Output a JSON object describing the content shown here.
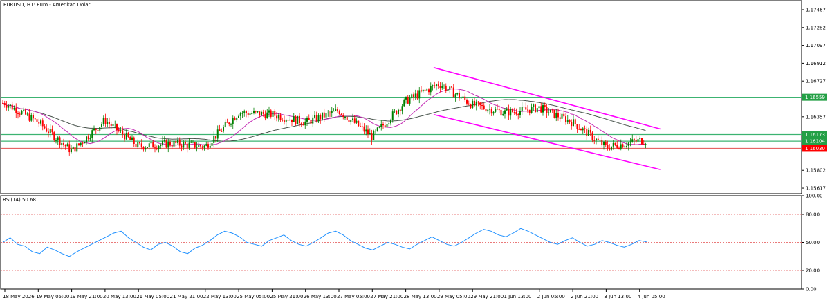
{
  "header": {
    "symbol_label": "EURUSD, H1:  Euro - Amerikan Dolari",
    "rsi_label": "RSI(14) 50.68"
  },
  "colors": {
    "background": "#ffffff",
    "frame": "#000000",
    "bull_candle": "#008000",
    "bear_candle": "#ff0000",
    "horizontal_level": "#3cb371",
    "bid_line": "#e34d4d",
    "channel": "#ff00ff",
    "ma_fast": "#c42ab4",
    "ma_slow": "#46524a",
    "rsi_line": "#1e90ff",
    "rsi_levels": "#e34d4d",
    "level_tag_bg": "#24a046",
    "bid_tag_bg": "#ff0000"
  },
  "chart_data": [
    {
      "type": "candlestick",
      "title": "EURUSD, H1:  Euro - Amerikan Dolari",
      "ylim": [
        1.1556,
        1.1756
      ],
      "y_ticks": [
        "1.17467",
        "1.17282",
        "1.17097",
        "1.16912",
        "1.16727",
        "1.16357",
        "1.15802",
        "1.15617"
      ],
      "x_ticks": [
        "18 May 2026",
        "19 May 05:00",
        "19 May 21:00",
        "20 May 13:00",
        "21 May 05:00",
        "21 May 21:00",
        "22 May 13:00",
        "25 May 05:00",
        "25 May 21:00",
        "26 May 13:00",
        "27 May 05:00",
        "27 May 21:00",
        "28 May 13:00",
        "29 May 05:00",
        "29 May 21:00",
        "1 Jun 13:00",
        "2 Jun 05:00",
        "2 Jun 21:00",
        "3 Jun 13:00",
        "4 Jun 05:00"
      ],
      "horizontal_levels": [
        {
          "value": 1.16559,
          "label": "1.16559"
        },
        {
          "value": 1.16173,
          "label": "1.16173"
        },
        {
          "value": 1.16104,
          "label": "1.16104"
        }
      ],
      "bid": {
        "value": 1.1603,
        "label": "1.16030"
      },
      "channel_lines": [
        {
          "from": [
            "29 May 05:00",
            1.16867
          ],
          "to": [
            "4 Jun 05:00",
            1.1623
          ]
        },
        {
          "from": [
            "29 May 05:00",
            1.1638
          ],
          "to": [
            "4 Jun 05:00",
            1.1581
          ]
        }
      ],
      "close_path": [
        [
          "18 May 2026",
          1.165
        ],
        [
          "19 May 05:00",
          1.163
        ],
        [
          "19 May 21:00",
          1.16
        ],
        [
          "20 May 13:00",
          1.1632
        ],
        [
          "21 May 05:00",
          1.1605
        ],
        [
          "21 May 21:00",
          1.1608
        ],
        [
          "22 May 13:00",
          1.1605
        ],
        [
          "25 May 05:00",
          1.164
        ],
        [
          "25 May 21:00",
          1.1638
        ],
        [
          "26 May 13:00",
          1.163
        ],
        [
          "27 May 05:00",
          1.1642
        ],
        [
          "27 May 21:00",
          1.1615
        ],
        [
          "28 May 13:00",
          1.1652
        ],
        [
          "29 May 05:00",
          1.167
        ],
        [
          "29 May 21:00",
          1.1648
        ],
        [
          "1 Jun 13:00",
          1.164
        ],
        [
          "2 Jun 05:00",
          1.1645
        ],
        [
          "2 Jun 21:00",
          1.163
        ],
        [
          "3 Jun 13:00",
          1.1604
        ],
        [
          "4 Jun 05:00",
          1.1611
        ]
      ]
    },
    {
      "type": "line",
      "title": "RSI(14) 50.68",
      "ylim": [
        0,
        100
      ],
      "y_ticks": [
        "100.00",
        "80.00",
        "50.00",
        "20.00",
        "0.00"
      ],
      "levels": [
        80,
        50,
        20
      ],
      "last_value": 50.68,
      "series": [
        {
          "values": [
            50,
            55,
            48,
            46,
            40,
            38,
            45,
            42,
            38,
            35,
            40,
            44,
            48,
            52,
            56,
            60,
            62,
            55,
            50,
            45,
            42,
            48,
            50,
            46,
            40,
            38,
            44,
            47,
            52,
            58,
            62,
            60,
            56,
            50,
            48,
            46,
            52,
            55,
            58,
            52,
            48,
            46,
            50,
            55,
            60,
            62,
            58,
            52,
            48,
            44,
            42,
            46,
            50,
            48,
            45,
            43,
            48,
            52,
            56,
            52,
            48,
            46,
            50,
            55,
            60,
            64,
            62,
            58,
            56,
            60,
            65,
            62,
            58,
            54,
            50,
            48,
            52,
            55,
            50,
            46,
            48,
            52,
            50,
            47,
            45,
            48,
            52,
            50.68
          ]
        }
      ]
    }
  ]
}
